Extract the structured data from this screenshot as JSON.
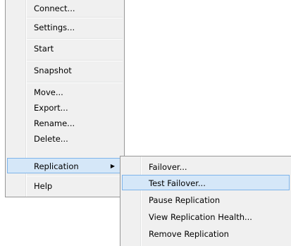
{
  "context_menu": {
    "items": [
      {
        "label": "Connect..."
      },
      {
        "label": "Settings..."
      },
      {
        "label": "Start"
      },
      {
        "label": "Snapshot"
      },
      {
        "label": "Move..."
      },
      {
        "label": "Export..."
      },
      {
        "label": "Rename..."
      },
      {
        "label": "Delete..."
      },
      {
        "label": "Replication",
        "arrow": "▶"
      },
      {
        "label": "Help"
      }
    ]
  },
  "replication_submenu": {
    "items": [
      {
        "label": "Failover..."
      },
      {
        "label": "Test Failover..."
      },
      {
        "label": "Pause Replication"
      },
      {
        "label": "View Replication Health..."
      },
      {
        "label": "Remove Replication"
      }
    ]
  },
  "colors": {
    "menu_background": "#f0f0f0",
    "highlight_background": "#d5e7f8",
    "highlight_border": "#7eb4ea"
  }
}
